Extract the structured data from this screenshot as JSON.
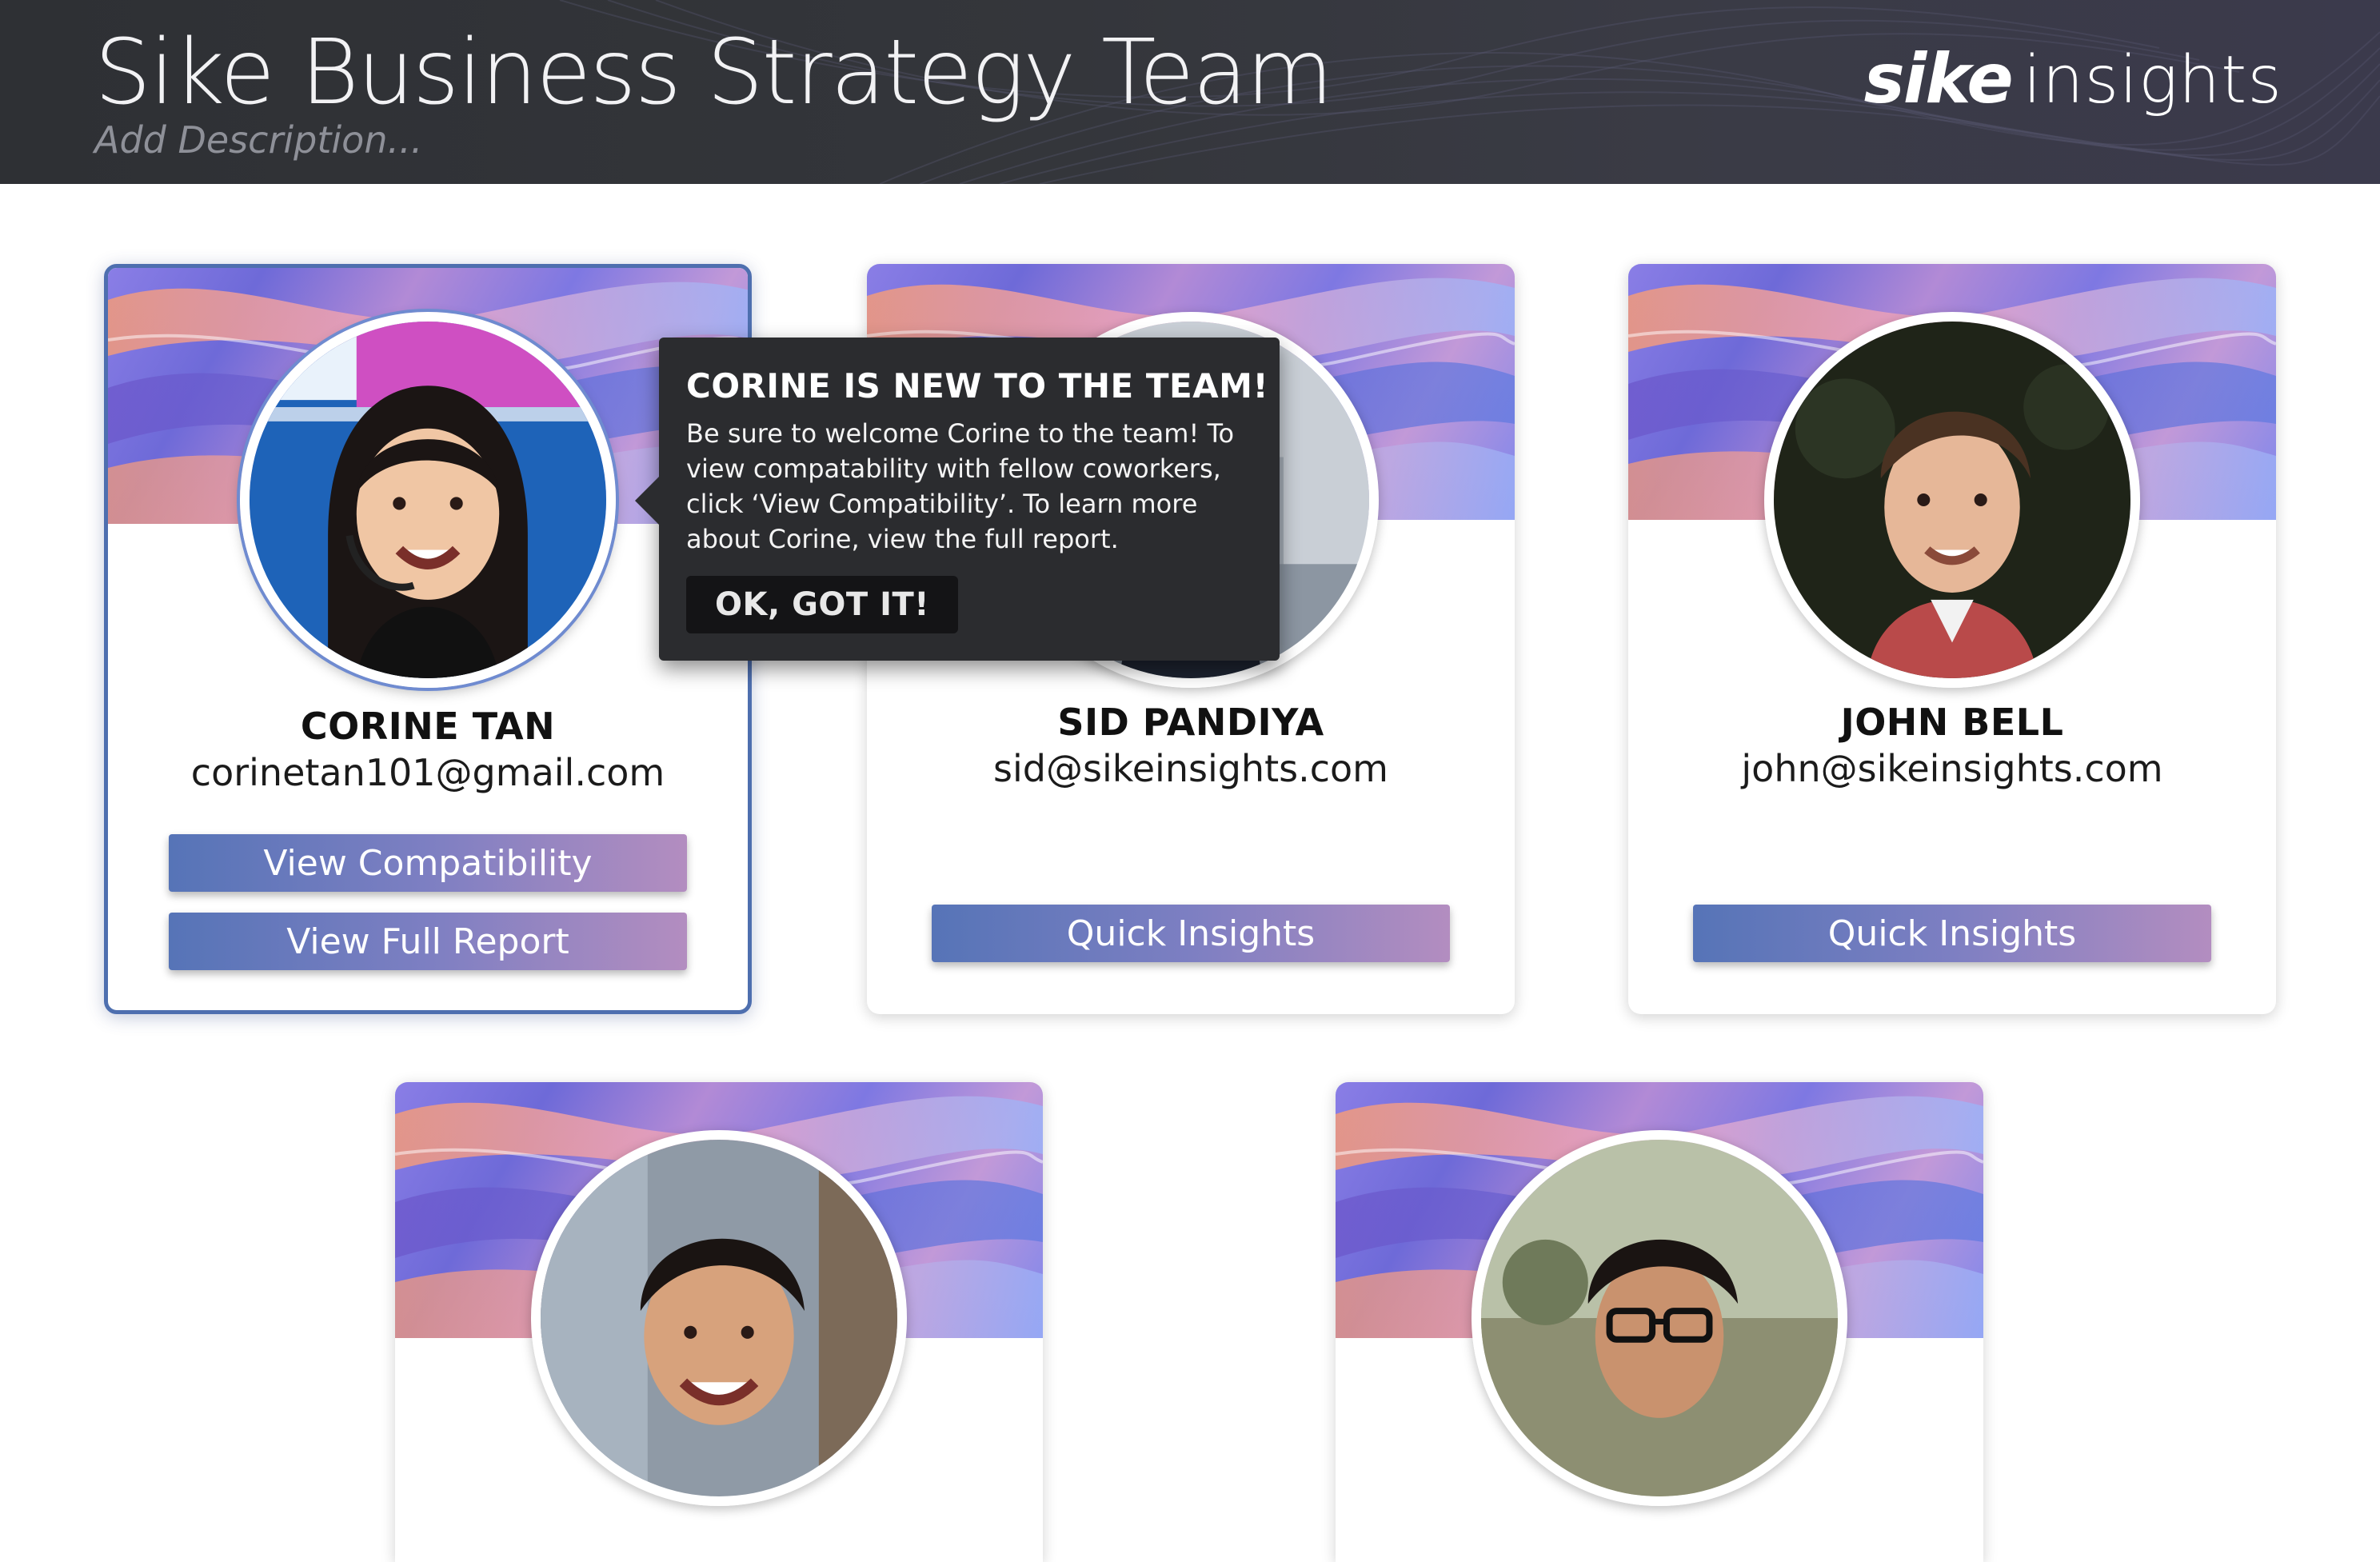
{
  "header": {
    "title": "Sike Business Strategy Team",
    "description_placeholder": "Add Description...",
    "brand_bold": "sike",
    "brand_light": "insights"
  },
  "members": [
    {
      "name": "CORINE TAN",
      "email": "corinetan101@gmail.com",
      "selected": true,
      "buttons": [
        "View Compatibility",
        "View Full Report"
      ]
    },
    {
      "name": "SID PANDIYA",
      "email": "sid@sikeinsights.com",
      "buttons": [
        "Quick Insights"
      ]
    },
    {
      "name": "JOHN BELL",
      "email": "john@sikeinsights.com",
      "buttons": [
        "Quick Insights"
      ]
    }
  ],
  "tooltip": {
    "title": "CORINE IS NEW TO THE TEAM!",
    "body": "Be sure to welcome Corine to the team! To view compatability with fellow coworkers, click ‘View Compatibility’. To learn more about Corine, view the full report.",
    "button": "OK, GOT IT!"
  },
  "colors": {
    "header_bg": "#2e3034",
    "card_border_selected": "#4e6faf",
    "button_gradient_start": "#5674b7",
    "button_gradient_end": "#b38dc0",
    "tooltip_bg": "#2b2c2f"
  },
  "icons": [
    "sike-insights-logo"
  ]
}
